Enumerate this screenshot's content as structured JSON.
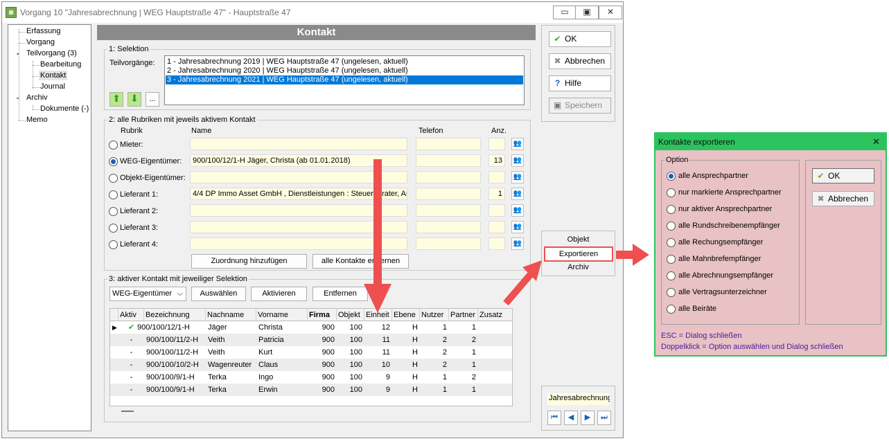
{
  "window": {
    "title": "Vorgang 10 \"Jahresabrechnung | WEG Hauptstraße 47\" - Hauptstraße 47",
    "btn_min": "▭",
    "btn_max": "▣",
    "btn_close": "✕"
  },
  "tree": {
    "items": [
      "Erfassung",
      "Vorgang",
      "Teilvorgang (3)",
      "Bearbeitung",
      "Kontakt",
      "Journal",
      "Archiv",
      "Dokumente (-)",
      "Memo"
    ]
  },
  "header": {
    "title": "Kontakt"
  },
  "selektion": {
    "group": "1: Selektion",
    "label": "Teilvorgänge:",
    "items": [
      "1 - Jahresabrechnung 2019 | WEG Hauptstraße 47 (ungelesen, aktuell)",
      "2 - Jahresabrechnung 2020 | WEG Hauptstraße 47 (ungelesen, aktuell)",
      "3 - Jahresabrechnung 2021 | WEG Hauptstraße 47 (ungelesen, aktuell)"
    ],
    "more": "..."
  },
  "rubriken": {
    "group": "2: alle Rubriken mit jeweils aktivem Kontakt",
    "col_rubrik": "Rubrik",
    "col_name": "Name",
    "col_telefon": "Telefon",
    "col_anz": "Anz.",
    "rows": [
      {
        "label": "Mieter:",
        "name": "",
        "tel": "",
        "anz": ""
      },
      {
        "label": "WEG-Eigentümer:",
        "name": "900/100/12/1-H  Jäger, Christa  (ab 01.01.2018)",
        "tel": "",
        "anz": "13"
      },
      {
        "label": "Objekt-Eigentümer:",
        "name": "",
        "tel": "",
        "anz": ""
      },
      {
        "label": "Lieferant 1:",
        "name": "4/4  DP Immo Asset GmbH  , Dienstleistungen : Steuerberater, An",
        "tel": "",
        "anz": "1"
      },
      {
        "label": "Lieferant 2:",
        "name": "",
        "tel": "",
        "anz": ""
      },
      {
        "label": "Lieferant 3:",
        "name": "",
        "tel": "",
        "anz": ""
      },
      {
        "label": "Lieferant 4:",
        "name": "",
        "tel": "",
        "anz": ""
      }
    ],
    "btn_zuordnung": "Zuordnung hinzufügen",
    "btn_alle_entfernen": "alle Kontakte entfernen"
  },
  "aktiv": {
    "group": "3: aktiver Kontakt mit jeweiliger Selektion",
    "combo": "WEG-Eigentümer",
    "combo_arrow": "⌵",
    "btn_auswaehlen": "Auswählen",
    "btn_aktivieren": "Aktivieren",
    "btn_entfernen": "Entfernen",
    "columns": [
      "Aktiv",
      "Bezeichnung",
      "Nachname",
      "Vorname",
      "Firma",
      "Objekt",
      "Einheit",
      "Ebene",
      "Nutzer",
      "Partner",
      "Zusatz"
    ],
    "rows": [
      {
        "aktiv": "✔",
        "bez": "900/100/12/1-H",
        "nach": "Jäger",
        "vor": "Christa",
        "objekt": "900",
        "einheit": "100",
        "ebene": "12",
        "nutzer": "H",
        "partner": "1",
        "zusatz": "1"
      },
      {
        "aktiv": "-",
        "bez": "900/100/11/2-H",
        "nach": "Veith",
        "vor": "Patricia",
        "objekt": "900",
        "einheit": "100",
        "ebene": "11",
        "nutzer": "H",
        "partner": "2",
        "zusatz": "2"
      },
      {
        "aktiv": "-",
        "bez": "900/100/11/2-H",
        "nach": "Veith",
        "vor": "Kurt",
        "objekt": "900",
        "einheit": "100",
        "ebene": "11",
        "nutzer": "H",
        "partner": "2",
        "zusatz": "1"
      },
      {
        "aktiv": "-",
        "bez": "900/100/10/2-H",
        "nach": "Wagenreuter",
        "vor": "Claus",
        "objekt": "900",
        "einheit": "100",
        "ebene": "10",
        "nutzer": "H",
        "partner": "2",
        "zusatz": "1"
      },
      {
        "aktiv": "-",
        "bez": "900/100/9/1-H",
        "nach": "Terka",
        "vor": "Ingo",
        "objekt": "900",
        "einheit": "100",
        "ebene": "9",
        "nutzer": "H",
        "partner": "1",
        "zusatz": "2"
      },
      {
        "aktiv": "-",
        "bez": "900/100/9/1-H",
        "nach": "Terka",
        "vor": "Erwin",
        "objekt": "900",
        "einheit": "100",
        "ebene": "9",
        "nutzer": "H",
        "partner": "1",
        "zusatz": "1"
      }
    ]
  },
  "side": {
    "ok": "OK",
    "abbrechen": "Abbrechen",
    "hilfe": "Hilfe",
    "speichern": "Speichern",
    "objekt": "Objekt",
    "exportieren": "Exportieren",
    "archiv": "Archiv",
    "nav_label": "Jahresabrechnung"
  },
  "dialog": {
    "title": "Kontakte exportieren",
    "close": "✕",
    "option": "Option",
    "options": [
      "alle Ansprechpartner",
      "nur markierte Ansprechpartner",
      "nur aktiver Ansprechpartner",
      "alle Rundschreibenempfänger",
      "alle Rechungsempfänger",
      "alle Mahnbrefempfänger",
      "alle Abrechnungsempfänger",
      "alle Vertragsunterzeichner",
      "alle Beiräte"
    ],
    "ok": "OK",
    "abbrechen": "Abbrechen",
    "hint1": "ESC = Dialog schließen",
    "hint2": "Doppelklick = Option auswählen und Dialog schließen"
  },
  "colors": {
    "accent_green": "#2cc35e",
    "dialog_bg": "#e8c2c5",
    "annotation_red": "#ee4f4f",
    "selection_blue": "#0078d7",
    "highlight_yellow": "#fffde0"
  }
}
